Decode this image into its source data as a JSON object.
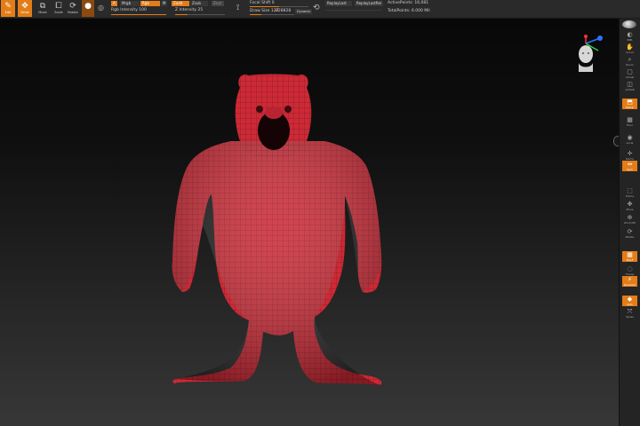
{
  "toolbar": {
    "tools": [
      {
        "label": "Edit",
        "icon": "edit-icon",
        "active": true
      },
      {
        "label": "Draw",
        "icon": "draw-icon",
        "active": true
      },
      {
        "label": "Move",
        "icon": "move-icon",
        "active": false
      },
      {
        "label": "Scale",
        "icon": "scale-icon",
        "active": false
      },
      {
        "label": "Rotate",
        "icon": "rotate-icon",
        "active": false
      }
    ],
    "material_icon": "material-sphere-icon",
    "a_label": "A",
    "mrgb": "Mrgb",
    "rgb": "Rgb",
    "m": "M",
    "zadd": "Zadd",
    "zsub": "Zsub",
    "zcut": "Zcut",
    "rgb_intensity": "Rgb Intensity 100",
    "z_intensity": "Z Intensity 25",
    "focal_shift": "Focal Shift 0",
    "draw_size": "Draw Size 127",
    "draw_size_extra": "828828",
    "dynamic": "Dynamic",
    "replay_last": "ReplayLast",
    "replay_last_rel": "ReplayLastRel",
    "active_points": "ActivePoints: 16,081",
    "total_points": "TotalPoints: 6.000 Mil",
    "rgb_intensity_value": 1.0,
    "z_intensity_value": 0.25,
    "focal_shift_value": 0.5,
    "draw_size_value": 0.25
  },
  "canvas": {
    "model_color": "#cc2a36",
    "wire_color": "#5a0f18"
  },
  "shelf": {
    "items": [
      {
        "label": "BPR",
        "icon": "render-icon",
        "active": false
      },
      {
        "label": "Scroll",
        "icon": "scroll-icon",
        "active": false
      },
      {
        "label": "Zoom",
        "icon": "zoom-icon",
        "active": false
      },
      {
        "label": "Actual",
        "icon": "actual-icon",
        "active": false
      },
      {
        "label": "AAHalf",
        "icon": "aahalf-icon",
        "active": false
      },
      {
        "label": "Persp",
        "icon": "perspective-icon",
        "active": true
      },
      {
        "label": "Floor",
        "icon": "floor-icon",
        "active": false
      },
      {
        "label": "Local",
        "icon": "local-icon",
        "active": false
      },
      {
        "label": "Gizmo",
        "icon": "gizmo-icon",
        "active": false
      },
      {
        "label": "Sym",
        "icon": "symmetry-icon",
        "active": true
      },
      {
        "label": "Frame",
        "icon": "frame-icon",
        "active": false
      },
      {
        "label": "Move",
        "icon": "move-icon",
        "active": false
      },
      {
        "label": "Zoom3D",
        "icon": "zoom3d-icon",
        "active": false
      },
      {
        "label": "Rotate",
        "icon": "rotate-icon",
        "active": false
      },
      {
        "label": "PolyF",
        "icon": "polyframe-icon",
        "active": true
      },
      {
        "label": "Transp",
        "icon": "transparency-icon",
        "active": false
      },
      {
        "label": "Dynamic",
        "icon": "dynamic-icon",
        "active": true
      },
      {
        "label": "Solo",
        "icon": "solo-icon",
        "active": true
      },
      {
        "label": "Xpose",
        "icon": "xpose-icon",
        "active": false
      }
    ]
  }
}
